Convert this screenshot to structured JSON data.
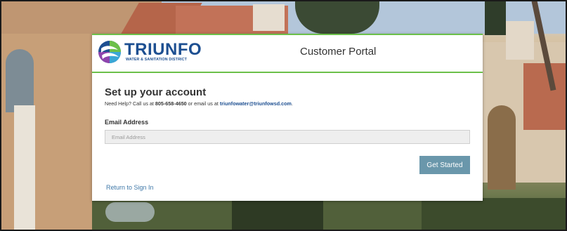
{
  "header": {
    "logo_name": "TRIUNFO",
    "logo_subtitle": "WATER & SANITATION DISTRICT",
    "portal_title": "Customer Portal"
  },
  "main": {
    "heading": "Set up your account",
    "help_prefix": "Need Help? Call us at ",
    "help_phone": "805-658-4650",
    "help_middle": " or email us at ",
    "help_email": "triunfowater@triunfowsd.com",
    "help_suffix": ".",
    "email_label": "Email Address",
    "email_value": "",
    "email_placeholder": "Email Address",
    "get_started_label": "Get Started",
    "return_link_label": "Return to Sign In"
  },
  "colors": {
    "brand_blue": "#1d4f91",
    "accent_green": "#6cc04a",
    "button": "#6a97ab",
    "link": "#3f78a8"
  }
}
